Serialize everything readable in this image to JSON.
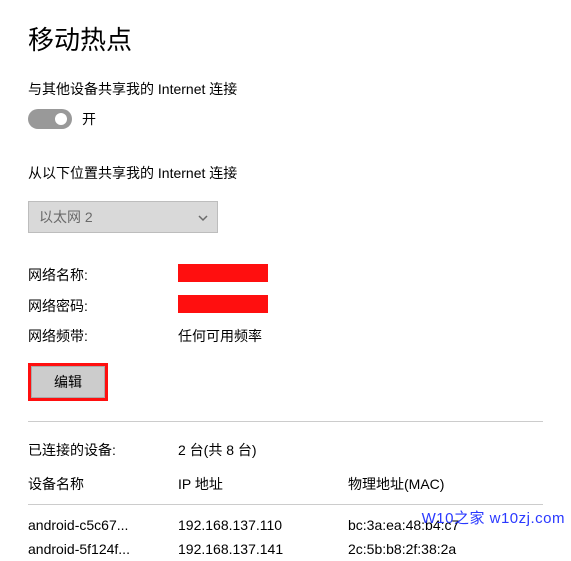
{
  "title": "移动热点",
  "share_label": "与其他设备共享我的 Internet 连接",
  "toggle_state_label": "开",
  "share_from_label": "从以下位置共享我的 Internet 连接",
  "dropdown_selected": "以太网 2",
  "info": {
    "network_name_label": "网络名称:",
    "network_password_label": "网络密码:",
    "network_band_label": "网络频带:",
    "network_band_value": "任何可用频率"
  },
  "edit_button_label": "编辑",
  "connected": {
    "label": "已连接的设备:",
    "value": "2 台(共 8 台)"
  },
  "table": {
    "headers": [
      "设备名称",
      "IP 地址",
      "物理地址(MAC)"
    ],
    "rows": [
      [
        "android-c5c67...",
        "192.168.137.110",
        "bc:3a:ea:48:b4:c7"
      ],
      [
        "android-5f124f...",
        "192.168.137.141",
        "2c:5b:b8:2f:38:2a"
      ]
    ]
  },
  "watermark": "W10之家 w10zj.com"
}
